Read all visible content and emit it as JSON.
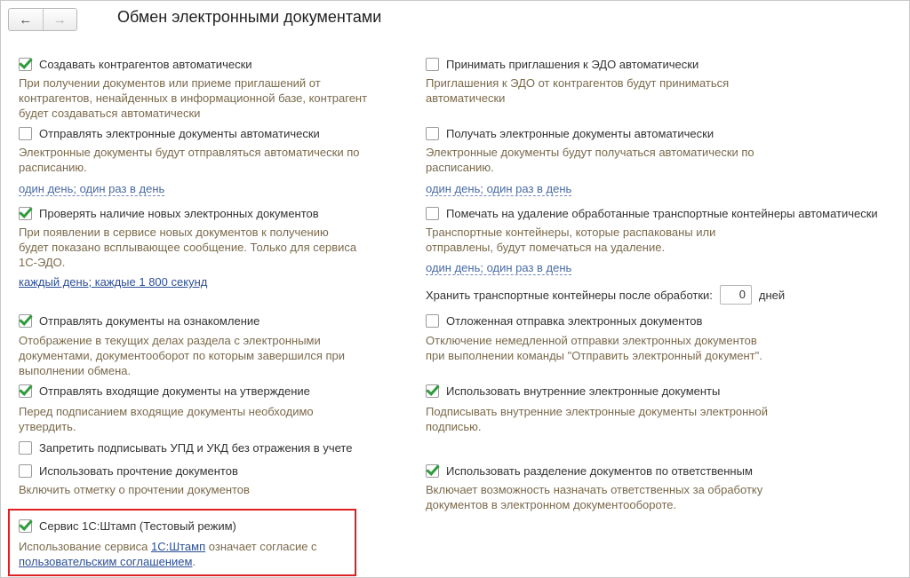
{
  "window": {
    "title": "Обмен электронными документами"
  },
  "nav": {
    "back": "←",
    "forward": "→"
  },
  "left": {
    "create_counterparties": {
      "label": "Создавать контрагентов автоматически",
      "checked": true,
      "desc": [
        "При получении документов или приеме приглашений от",
        "контрагентов, ненайденных в информационной базе, контрагент",
        "будет создаваться автоматически"
      ]
    },
    "send_auto": {
      "label": "Отправлять электронные документы автоматически",
      "checked": false,
      "desc": [
        "Электронные документы будут отправляться автоматически по",
        "расписанию."
      ],
      "schedule": "один день; один раз в день"
    },
    "check_new": {
      "label": "Проверять наличие новых электронных документов",
      "checked": true,
      "desc": [
        "При появлении в сервисе новых документов к получению",
        "будет показано всплывающее сообщение. Только для сервиса",
        "1С-ЭДО."
      ],
      "schedule": "каждый день; каждые 1 800 секунд"
    },
    "send_review": {
      "label": "Отправлять документы на ознакомление",
      "checked": true,
      "desc": [
        "Отображение в текущих делах  раздела с электронными",
        "документами, документооборот по которым завершился при",
        "выполнении обмена."
      ]
    },
    "send_approval": {
      "label": "Отправлять входящие документы на утверждение",
      "checked": true,
      "desc": [
        "Перед подписанием входящие документы необходимо",
        "утвердить."
      ]
    },
    "forbid_sign": {
      "label": "Запретить подписывать УПД и УКД без отражения в учете",
      "checked": false
    },
    "use_reading": {
      "label": "Использовать прочтение документов",
      "checked": false,
      "desc": [
        "Включить отметку о прочтении документов"
      ]
    },
    "stamp": {
      "label": "Сервис 1С:Штамп (Тестовый режим)",
      "checked": true,
      "desc_prefix": "Использование сервиса ",
      "desc_link": "1С:Штамп",
      "desc_mid": " означает согласие с",
      "desc_link2": "пользовательским соглашением",
      "desc_suffix": "."
    }
  },
  "right": {
    "accept_invites": {
      "label": "Принимать приглашения к ЭДО автоматически",
      "checked": false,
      "desc": [
        "Приглашения к ЭДО от контрагентов будут приниматься",
        "автоматически"
      ]
    },
    "receive_auto": {
      "label": "Получать электронные документы автоматически",
      "checked": false,
      "desc": [
        "Электронные документы будут получаться автоматически по",
        "расписанию."
      ],
      "schedule": "один день; один раз в день"
    },
    "mark_delete": {
      "label": "Помечать на удаление обработанные транспортные контейнеры автоматически",
      "checked": false,
      "desc": [
        "Транспортные контейнеры, которые распакованы или",
        "отправлены, будут помечаться на удаление."
      ],
      "schedule": "один день; один раз в день"
    },
    "store": {
      "label": "Хранить транспортные контейнеры после обработки:",
      "value": "0",
      "unit": "дней"
    },
    "delayed_send": {
      "label": "Отложенная отправка электронных документов",
      "checked": false,
      "desc": [
        "Отключение немедленной отправки электронных документов",
        "при выполнении команды \"Отправить электронный документ\"."
      ]
    },
    "internal_docs": {
      "label": "Использовать внутренние электронные документы",
      "checked": true,
      "desc": [
        "Подписывать внутренние электронные документы электронной",
        "подписью."
      ]
    },
    "responsible": {
      "label": "Использовать разделение документов по ответственным",
      "checked": true,
      "desc": [
        "Включает возможность назначать ответственных за обработку",
        "документов в электронном документообороте."
      ]
    }
  },
  "colors": {
    "check": "#2e9c3a",
    "link": "#4a6ba3",
    "hint": "#7a6a4c",
    "highlight": "#e02020"
  }
}
